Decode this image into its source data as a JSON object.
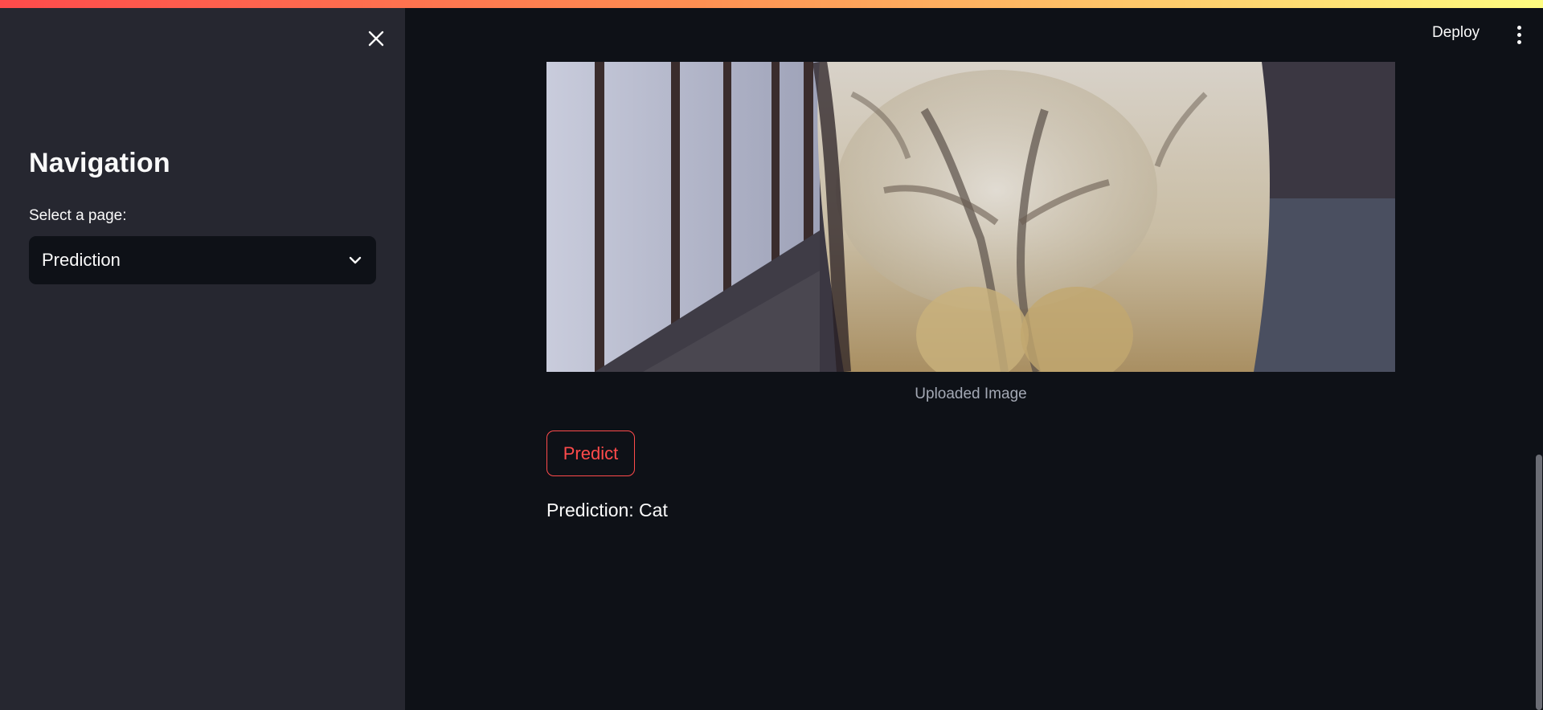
{
  "sidebar": {
    "title": "Navigation",
    "select_label": "Select a page:",
    "select_value": "Prediction",
    "close_icon": "close-icon",
    "chevron_icon": "chevron-down-icon"
  },
  "header": {
    "deploy_label": "Deploy",
    "menu_icon": "more-vertical-icon"
  },
  "main": {
    "image_caption": "Uploaded Image",
    "predict_label": "Predict",
    "prediction_text": "Prediction: Cat"
  },
  "colors": {
    "sidebar_bg": "#262730",
    "main_bg": "#0e1117",
    "accent": "#ff4b4b",
    "caption": "#a3a8b4"
  }
}
